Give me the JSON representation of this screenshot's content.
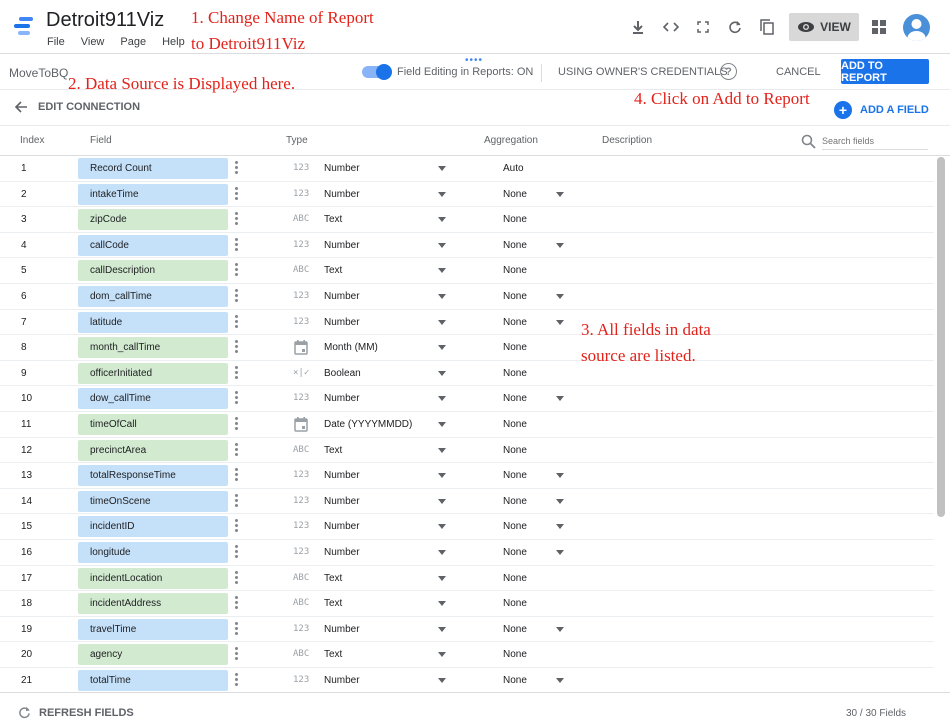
{
  "app": {
    "report_title": "Detroit911Viz",
    "menu": [
      "File",
      "View",
      "Page",
      "Help"
    ],
    "view_button": "VIEW"
  },
  "annotations": {
    "a1_line1": "1. Change Name of Report",
    "a1_line2": "to Detroit911Viz",
    "a2": "2. Data Source is Displayed here.",
    "a3_line1": "3. All fields in data",
    "a3_line2": "source are listed.",
    "a4": "4. Click on Add to Report"
  },
  "datasource": {
    "name": "MoveToBQ",
    "field_editing": "Field Editing in Reports: ON",
    "credentials": "USING OWNER'S CREDENTIALS",
    "cancel": "CANCEL",
    "add_to_report": "ADD TO REPORT"
  },
  "edit": {
    "edit_connection": "EDIT CONNECTION",
    "add_field": "ADD A FIELD"
  },
  "table": {
    "headers": {
      "index": "Index",
      "field": "Field",
      "type": "Type",
      "aggregation": "Aggregation",
      "description": "Description"
    },
    "search_placeholder": "Search fields",
    "rows": [
      {
        "index": "1",
        "field": "Record Count",
        "color": "blue",
        "type_icon": "123",
        "type": "Number",
        "agg": "Auto",
        "agg_dropdown": false
      },
      {
        "index": "2",
        "field": "intakeTime",
        "color": "blue",
        "type_icon": "123",
        "type": "Number",
        "agg": "None",
        "agg_dropdown": true
      },
      {
        "index": "3",
        "field": "zipCode",
        "color": "green",
        "type_icon": "ABC",
        "type": "Text",
        "agg": "None",
        "agg_dropdown": false
      },
      {
        "index": "4",
        "field": "callCode",
        "color": "blue",
        "type_icon": "123",
        "type": "Number",
        "agg": "None",
        "agg_dropdown": true
      },
      {
        "index": "5",
        "field": "callDescription",
        "color": "green",
        "type_icon": "ABC",
        "type": "Text",
        "agg": "None",
        "agg_dropdown": false
      },
      {
        "index": "6",
        "field": "dom_callTime",
        "color": "blue",
        "type_icon": "123",
        "type": "Number",
        "agg": "None",
        "agg_dropdown": true
      },
      {
        "index": "7",
        "field": "latitude",
        "color": "blue",
        "type_icon": "123",
        "type": "Number",
        "agg": "None",
        "agg_dropdown": true
      },
      {
        "index": "8",
        "field": "month_callTime",
        "color": "green",
        "type_icon": "calendar",
        "type": "Month (MM)",
        "agg": "None",
        "agg_dropdown": false
      },
      {
        "index": "9",
        "field": "officerInitiated",
        "color": "green",
        "type_icon": "×|✓",
        "type": "Boolean",
        "agg": "None",
        "agg_dropdown": false
      },
      {
        "index": "10",
        "field": "dow_callTime",
        "color": "blue",
        "type_icon": "123",
        "type": "Number",
        "agg": "None",
        "agg_dropdown": true
      },
      {
        "index": "11",
        "field": "timeOfCall",
        "color": "green",
        "type_icon": "calendar",
        "type": "Date (YYYYMMDD)",
        "agg": "None",
        "agg_dropdown": false
      },
      {
        "index": "12",
        "field": "precinctArea",
        "color": "green",
        "type_icon": "ABC",
        "type": "Text",
        "agg": "None",
        "agg_dropdown": false
      },
      {
        "index": "13",
        "field": "totalResponseTime",
        "color": "blue",
        "type_icon": "123",
        "type": "Number",
        "agg": "None",
        "agg_dropdown": true
      },
      {
        "index": "14",
        "field": "timeOnScene",
        "color": "blue",
        "type_icon": "123",
        "type": "Number",
        "agg": "None",
        "agg_dropdown": true
      },
      {
        "index": "15",
        "field": "incidentID",
        "color": "blue",
        "type_icon": "123",
        "type": "Number",
        "agg": "None",
        "agg_dropdown": true
      },
      {
        "index": "16",
        "field": "longitude",
        "color": "blue",
        "type_icon": "123",
        "type": "Number",
        "agg": "None",
        "agg_dropdown": true
      },
      {
        "index": "17",
        "field": "incidentLocation",
        "color": "green",
        "type_icon": "ABC",
        "type": "Text",
        "agg": "None",
        "agg_dropdown": false
      },
      {
        "index": "18",
        "field": "incidentAddress",
        "color": "green",
        "type_icon": "ABC",
        "type": "Text",
        "agg": "None",
        "agg_dropdown": false
      },
      {
        "index": "19",
        "field": "travelTime",
        "color": "blue",
        "type_icon": "123",
        "type": "Number",
        "agg": "None",
        "agg_dropdown": true
      },
      {
        "index": "20",
        "field": "agency",
        "color": "green",
        "type_icon": "ABC",
        "type": "Text",
        "agg": "None",
        "agg_dropdown": false
      },
      {
        "index": "21",
        "field": "totalTime",
        "color": "blue",
        "type_icon": "123",
        "type": "Number",
        "agg": "None",
        "agg_dropdown": true
      }
    ]
  },
  "footer": {
    "refresh": "REFRESH FIELDS",
    "field_count": "30 / 30 Fields"
  }
}
